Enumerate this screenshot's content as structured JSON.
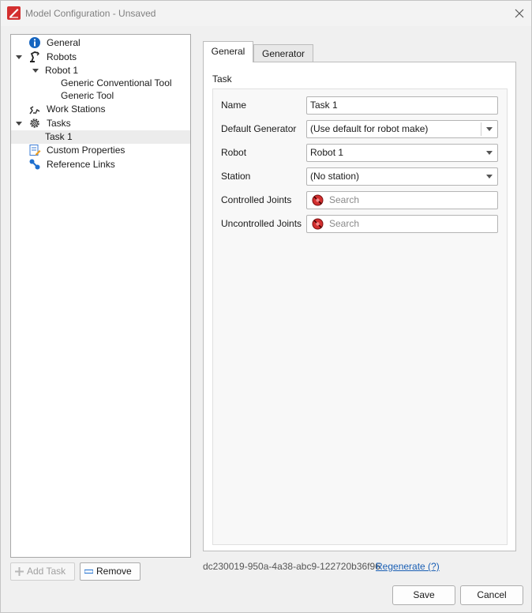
{
  "window": {
    "title": "Model Configuration - Unsaved"
  },
  "tree": {
    "items": [
      {
        "label": "General",
        "icon": "info-icon"
      },
      {
        "label": "Robots",
        "icon": "robot-arm-icon"
      },
      {
        "label": "Robot 1",
        "icon": ""
      },
      {
        "label": "Generic Conventional Tool",
        "icon": ""
      },
      {
        "label": "Generic Tool",
        "icon": ""
      },
      {
        "label": "Work Stations",
        "icon": "work-station-icon"
      },
      {
        "label": "Tasks",
        "icon": "gear-icon"
      },
      {
        "label": "Task 1",
        "icon": ""
      },
      {
        "label": "Custom Properties",
        "icon": "custom-properties-icon"
      },
      {
        "label": "Reference Links",
        "icon": "link-icon"
      }
    ]
  },
  "left_buttons": {
    "add_task": "Add Task",
    "remove": "Remove"
  },
  "tabs": [
    {
      "label": "General",
      "active": true
    },
    {
      "label": "Generator",
      "active": false
    }
  ],
  "task_group": {
    "label": "Task",
    "fields": {
      "name": {
        "label": "Name",
        "value": "Task 1"
      },
      "default_generator": {
        "label": "Default Generator",
        "value": "(Use default for robot make)"
      },
      "robot": {
        "label": "Robot",
        "value": "Robot 1"
      },
      "station": {
        "label": "Station",
        "value": "(No station)"
      },
      "controlled_joints": {
        "label": "Controlled Joints",
        "placeholder": "Search"
      },
      "uncontrolled_joints": {
        "label": "Uncontrolled Joints",
        "placeholder": "Search"
      }
    }
  },
  "footer": {
    "guid": "dc230019-950a-4a38-abc9-122720b36f96",
    "regenerate": "Regenerate (?)",
    "save": "Save",
    "cancel": "Cancel"
  },
  "colors": {
    "accent_red": "#d32f2f",
    "info_blue": "#1565c0",
    "link_blue": "#1a5fb4"
  }
}
